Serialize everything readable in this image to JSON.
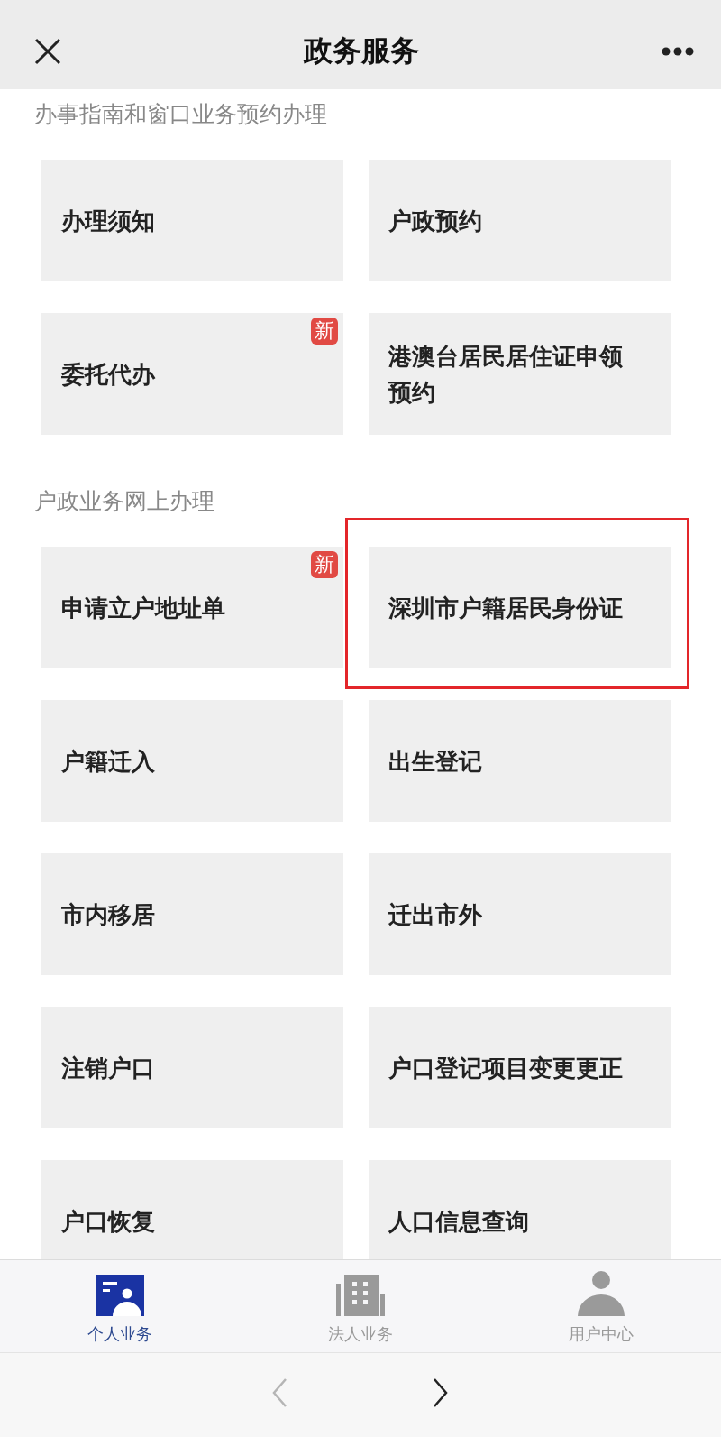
{
  "header": {
    "title": "政务服务"
  },
  "sections": [
    {
      "title": "办事指南和窗口业务预约办理",
      "items": [
        {
          "label": "办理须知",
          "highlighted": false
        },
        {
          "label": "户政预约",
          "highlighted": false
        },
        {
          "label": "委托代办",
          "badge": "新",
          "highlighted": false
        },
        {
          "label": "港澳台居民居住证申领预约",
          "highlighted": false
        }
      ]
    },
    {
      "title": "户政业务网上办理",
      "items": [
        {
          "label": "申请立户地址单",
          "badge": "新",
          "highlighted": false
        },
        {
          "label": "深圳市户籍居民身份证",
          "highlighted": true
        },
        {
          "label": "户籍迁入",
          "highlighted": false
        },
        {
          "label": "出生登记",
          "highlighted": false
        },
        {
          "label": "市内移居",
          "highlighted": false
        },
        {
          "label": "迁出市外",
          "highlighted": false
        },
        {
          "label": "注销户口",
          "highlighted": false
        },
        {
          "label": "户口登记项目变更更正",
          "highlighted": false
        },
        {
          "label": "户口恢复",
          "highlighted": false
        },
        {
          "label": "人口信息查询",
          "highlighted": false
        }
      ]
    }
  ],
  "tabs": [
    {
      "kind": "personal",
      "label": "个人业务",
      "selected": true
    },
    {
      "kind": "business",
      "label": "法人业务",
      "selected": false
    },
    {
      "kind": "user",
      "label": "用户中心",
      "selected": false
    }
  ],
  "nav": {
    "back_disabled": true,
    "forward_disabled": false
  }
}
